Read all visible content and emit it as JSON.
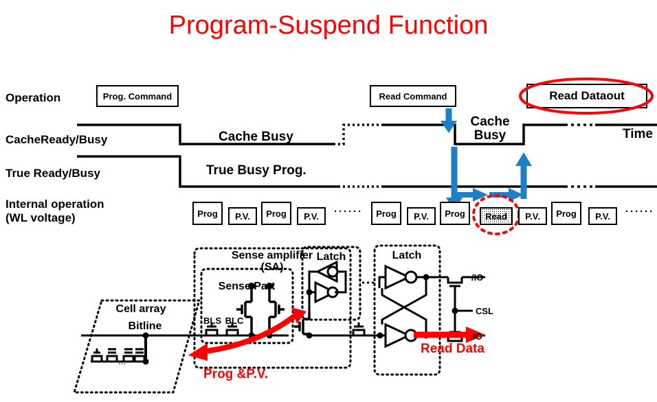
{
  "title": "Program-Suspend Function",
  "colors": {
    "accent_red": "#ff0000",
    "arrow_blue": "#1f7fc4",
    "line_black": "#000000"
  },
  "timing_diagram": {
    "row_labels": [
      {
        "id": "operation",
        "text": "Operation"
      },
      {
        "id": "cache-ready-busy",
        "text": "CacheReady/Busy"
      },
      {
        "id": "true-ready-busy",
        "text": "True Ready/Busy"
      },
      {
        "id": "internal-operation",
        "text": "Internal operation\n(WL voltage)"
      }
    ],
    "axis_label": "Time",
    "command_boxes": [
      {
        "id": "prog-command",
        "text": "Prog. Command",
        "highlighted": false
      },
      {
        "id": "read-command",
        "text": "Read Command",
        "highlighted": false
      },
      {
        "id": "read-dataout",
        "text": "Read Dataout",
        "highlighted": true
      }
    ],
    "waveform_labels": [
      {
        "id": "cache-busy-1",
        "text": "Cache Busy"
      },
      {
        "id": "true-busy-prog",
        "text": "True Busy Prog."
      },
      {
        "id": "cache-busy-2",
        "text": "Cache\nBusy"
      }
    ],
    "internal_ops": [
      {
        "id": "op-1",
        "text": "Prog",
        "kind": "prog"
      },
      {
        "id": "op-2",
        "text": "P.V.",
        "kind": "pv"
      },
      {
        "id": "op-3",
        "text": "Prog",
        "kind": "prog"
      },
      {
        "id": "op-4",
        "text": "P.V.",
        "kind": "pv"
      },
      {
        "id": "op-ellipsis-1",
        "text": "······",
        "kind": "ellipsis"
      },
      {
        "id": "op-5",
        "text": "Prog",
        "kind": "prog"
      },
      {
        "id": "op-6",
        "text": "P.V.",
        "kind": "pv"
      },
      {
        "id": "op-7",
        "text": "Prog",
        "kind": "prog"
      },
      {
        "id": "op-read",
        "text": "Read",
        "kind": "read-highlighted"
      },
      {
        "id": "op-8",
        "text": "P.V.",
        "kind": "pv"
      },
      {
        "id": "op-9",
        "text": "Prog",
        "kind": "prog"
      },
      {
        "id": "op-10",
        "text": "P.V.",
        "kind": "pv"
      },
      {
        "id": "op-ellipsis-2",
        "text": "······",
        "kind": "ellipsis"
      }
    ]
  },
  "circuit_diagram": {
    "blocks": [
      {
        "id": "cell-array",
        "text": "Cell array"
      },
      {
        "id": "sense-amplifier",
        "text": "Sense amplifier\n(SA)"
      },
      {
        "id": "sense-part",
        "text": "Sense Part"
      },
      {
        "id": "latch-1",
        "text": "Latch"
      },
      {
        "id": "latch-2",
        "text": "Latch"
      }
    ],
    "signal_labels": [
      {
        "id": "bitline",
        "text": "Bitline"
      },
      {
        "id": "bls",
        "text": "BLS"
      },
      {
        "id": "blc",
        "text": "BLC"
      },
      {
        "id": "io-bar",
        "text": "/IO"
      },
      {
        "id": "csl",
        "text": "CSL"
      },
      {
        "id": "io",
        "text": "IO"
      }
    ],
    "annotations": [
      {
        "id": "prog-pv-arrow-label",
        "text": "Prog &P.V."
      },
      {
        "id": "read-data-arrow-label",
        "text": "Read Data"
      }
    ]
  }
}
